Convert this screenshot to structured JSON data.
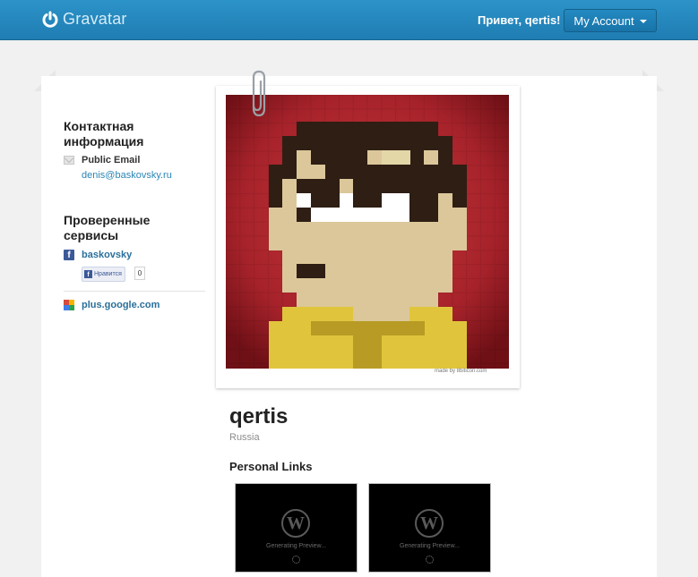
{
  "header": {
    "logo_text": "Gravatar",
    "greeting": "Привет, qertis!",
    "account_button": "My Account"
  },
  "sidebar": {
    "contact_title": "Контактная информация",
    "email_label": "Public Email",
    "email_value": "denis@baskovsky.ru",
    "verified_title": "Проверенные сервисы",
    "services": [
      {
        "icon": "facebook-icon",
        "name": "baskovsky",
        "like_label": "Нравится",
        "like_count": "0"
      },
      {
        "icon": "google-icon",
        "name": "plus.google.com"
      }
    ]
  },
  "avatar": {
    "credit": "made by 8biticon.com"
  },
  "profile": {
    "display_name": "qertis",
    "location": "Russia",
    "links_title": "Personal Links",
    "link_previews": [
      {
        "status": "Generating Preview..."
      },
      {
        "status": "Generating Preview..."
      }
    ]
  },
  "colors": {
    "topbar": "#2189c0",
    "accent_link": "#2a86b5",
    "background": "#f1f1f1"
  }
}
